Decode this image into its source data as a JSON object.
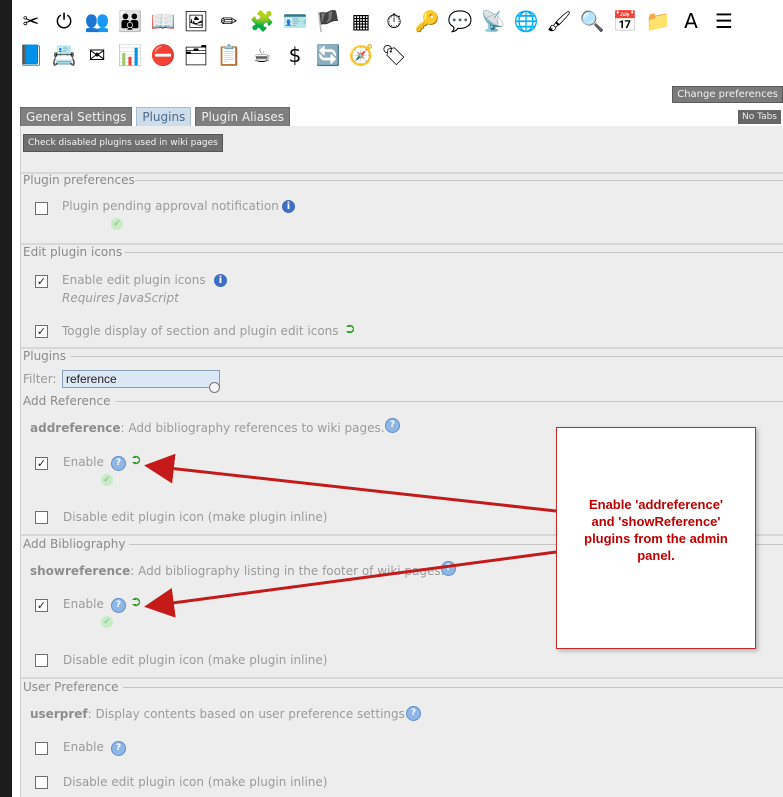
{
  "toolbar": {
    "row1": [
      {
        "icon": "admin-tools-icon",
        "glyph": "✂"
      },
      {
        "icon": "power-icon",
        "glyph": "⏻"
      },
      {
        "icon": "users-icon",
        "glyph": "👥"
      },
      {
        "icon": "group-icon",
        "glyph": "👪"
      },
      {
        "icon": "book-icon",
        "glyph": "📖"
      },
      {
        "icon": "image-icon",
        "glyph": "🖼"
      },
      {
        "icon": "edit-icon",
        "glyph": "✏"
      },
      {
        "icon": "modules-icon",
        "glyph": "🧩"
      },
      {
        "icon": "comment-icon",
        "glyph": "🪪"
      },
      {
        "icon": "language-icon",
        "glyph": "🏴"
      },
      {
        "icon": "table-icon",
        "glyph": "▦"
      },
      {
        "icon": "clock-icon",
        "glyph": "⏱"
      },
      {
        "icon": "key-icon",
        "glyph": "🔑"
      },
      {
        "icon": "chat-icon",
        "glyph": "💬"
      },
      {
        "icon": "rss-icon",
        "glyph": "📡"
      },
      {
        "icon": "globe-icon",
        "glyph": "🌐"
      },
      {
        "icon": "gallery-icon",
        "glyph": "🖌"
      },
      {
        "icon": "search-icon",
        "glyph": "🔍"
      },
      {
        "icon": "calendar-icon",
        "glyph": "📅"
      },
      {
        "icon": "files-icon",
        "glyph": "📁"
      },
      {
        "icon": "font-icon",
        "glyph": "A"
      },
      {
        "icon": "text-area-icon",
        "glyph": "☰"
      }
    ],
    "row2": [
      {
        "icon": "wiki-icon",
        "glyph": "📘"
      },
      {
        "icon": "contact-icon",
        "glyph": "📇"
      },
      {
        "icon": "mail-icon",
        "glyph": "✉"
      },
      {
        "icon": "stats-icon",
        "glyph": "📊"
      },
      {
        "icon": "blocked-icon",
        "glyph": "⛔"
      },
      {
        "icon": "sitemap-icon",
        "glyph": "🗂"
      },
      {
        "icon": "forms-icon",
        "glyph": "📋"
      },
      {
        "icon": "cup-icon",
        "glyph": "☕"
      },
      {
        "icon": "dollar-icon",
        "glyph": "$"
      },
      {
        "icon": "sync-icon",
        "glyph": "🔄"
      },
      {
        "icon": "compass-icon",
        "glyph": "🧭"
      },
      {
        "icon": "tag-icon",
        "glyph": "🏷"
      }
    ]
  },
  "buttons": {
    "change_preferences": "Change preferences",
    "no_tabs": "No Tabs",
    "check_disabled": "Check disabled plugins used in wiki pages"
  },
  "tabs": {
    "general": "General Settings",
    "plugins": "Plugins",
    "aliases": "Plugin Aliases"
  },
  "sections": {
    "plugin_prefs": {
      "legend": "Plugin preferences",
      "pending_label": "Plugin pending approval notification"
    },
    "edit_icons": {
      "legend": "Edit plugin icons",
      "enable_label": "Enable edit plugin icons",
      "requires": "Requires JavaScript",
      "toggle_label": "Toggle display of section and plugin edit icons"
    },
    "plugins": {
      "legend": "Plugins",
      "filter_label": "Filter:",
      "filter_value": "reference"
    },
    "add_reference": {
      "legend": "Add Reference",
      "name": "addreference",
      "desc": ": Add bibliography references to wiki pages.",
      "enable_label": "Enable",
      "disable_label": "Disable edit plugin icon (make plugin inline)"
    },
    "add_bibliography": {
      "legend": "Add Bibliography",
      "name": "showreference",
      "desc": ": Add bibliography listing in the footer of wiki pages.",
      "enable_label": "Enable",
      "disable_label": "Disable edit plugin icon (make plugin inline)"
    },
    "user_pref": {
      "legend": "User Preference",
      "name": "userpref",
      "desc": ": Display contents based on user preference settings",
      "enable_label": "Enable",
      "disable_label": "Disable edit plugin icon (make plugin inline)"
    }
  },
  "callout": {
    "text": "Enable 'addreference'\nand 'showReference'\nplugins from the admin\npanel."
  },
  "colors": {
    "callout_border": "#c12a2a",
    "callout_text": "#c00000",
    "arrow": "#c41a1a"
  }
}
